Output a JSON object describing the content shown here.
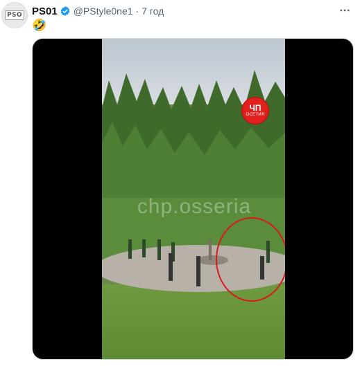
{
  "tweet": {
    "author": {
      "display_name": "PS01",
      "handle": "@PStyle0ne1",
      "avatar_logo": "PSO",
      "verified": true
    },
    "separator": "·",
    "timestamp": "7 год",
    "text": "🤣",
    "more_icon": "more-dots-icon",
    "media": {
      "type": "video",
      "watermark": "chp.osseria",
      "badge": {
        "line1": "ЧП",
        "line2": "ОСЕТИЯ",
        "color": "#e0201c"
      },
      "highlight_color": "#d81a1a"
    }
  },
  "colors": {
    "text_primary": "#0f1419",
    "text_secondary": "#536471",
    "verified_blue": "#1d9bf0"
  }
}
